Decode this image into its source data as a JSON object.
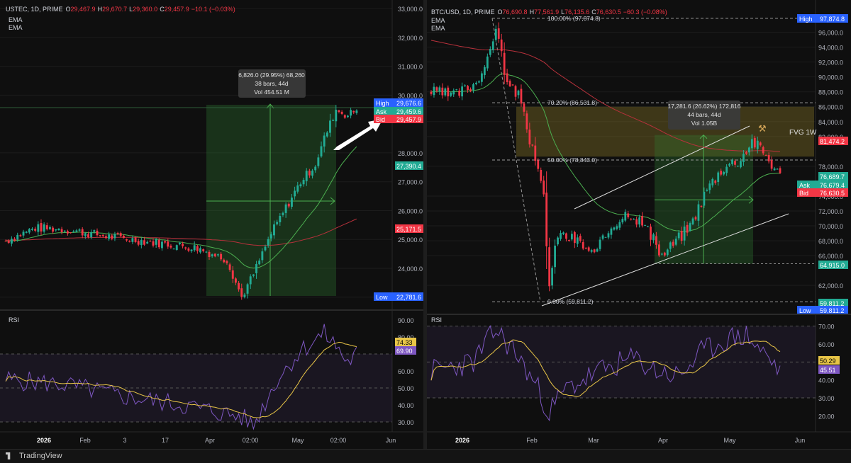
{
  "footer": {
    "brand": "TradingView"
  },
  "colors": {
    "up": "#22ab94",
    "down": "#f23645",
    "ema_green": "#4caf50",
    "ema_red": "#b7313b",
    "rsi": "#7e57c2",
    "rsi_ma": "#e8c547",
    "blue": "#2962ff"
  },
  "charts": [
    {
      "panel": "left",
      "header": {
        "symbol": "USTEC, 1D, PRIME",
        "o_label": "O",
        "o": "29,467.9",
        "h_label": "H",
        "h": "29,670.7",
        "l_label": "L",
        "l": "29,360.0",
        "c_label": "C",
        "c": "29,457.9",
        "chg": "−10.1 (−0.03%)"
      },
      "indicators": [
        "EMA",
        "EMA"
      ],
      "price_ticks": [
        "33,000.0",
        "32,000.0",
        "31,000.0",
        "30,000.0",
        "28,000.0",
        "27,000.0",
        "26,000.0",
        "25,000.0",
        "24,000.0",
        "23,000.0"
      ],
      "price_labels": [
        {
          "tag": "High",
          "value": "29,676.6",
          "color": "#2962ff"
        },
        {
          "tag": "Ask",
          "value": "29,459.6",
          "color": "#22ab94"
        },
        {
          "tag": "Bid",
          "value": "29,457.9",
          "color": "#f23645"
        },
        {
          "tag": "",
          "value": "27,390.4",
          "color": "#22ab94"
        },
        {
          "tag": "",
          "value": "25,171.5",
          "color": "#f23645"
        },
        {
          "tag": "Low",
          "value": "22,781.6",
          "color": "#2962ff"
        }
      ],
      "measure": {
        "line1": "6,826.0 (29.95%) 68,260",
        "line2": "38 bars, 44d",
        "line3": "Vol 454.51 M"
      },
      "rsi": {
        "label": "RSI",
        "ticks": [
          "90.00",
          "80.00",
          "60.00",
          "50.00",
          "40.00",
          "30.00"
        ],
        "value1": "74.33",
        "value2": "69.90"
      },
      "time_ticks": [
        "2026",
        "Feb",
        "3",
        "17",
        "Apr",
        "02:00",
        "May",
        "02:00",
        "Jun"
      ],
      "chart_data": {
        "type": "candlestick",
        "title": "USTEC, 1D, PRIME",
        "ylim": [
          22700,
          33100
        ],
        "ema_values": {
          "ema1_last": 27390.4,
          "ema2_last": 25171.5
        },
        "high": 29676.6,
        "low": 22781.6,
        "measure_range": [
          22781.6,
          29676.6
        ],
        "rsi_last": 69.9,
        "rsi_ma_last": 74.33
      }
    },
    {
      "panel": "right",
      "header": {
        "symbol": "BTC/USD, 1D, PRIME",
        "o_label": "O",
        "o": "76,690.8",
        "h_label": "H",
        "h": "77,561.9",
        "l_label": "L",
        "l": "76,135.6",
        "c_label": "C",
        "c": "76,630.5",
        "chg": "−60.3 (−0.08%)"
      },
      "indicators": [
        "EMA",
        "EMA"
      ],
      "price_ticks": [
        "96,000.0",
        "94,000.0",
        "92,000.0",
        "90,000.0",
        "88,000.0",
        "86,000.0",
        "84,000.0",
        "82,000.0",
        "78,000.0",
        "74,000.0",
        "72,000.0",
        "70,000.0",
        "68,000.0",
        "66,000.0",
        "62,000.0"
      ],
      "price_labels": [
        {
          "tag": "High",
          "value": "97,874.8",
          "color": "#2962ff"
        },
        {
          "tag": "",
          "value": "81,474.2",
          "color": "#f23645"
        },
        {
          "tag": "",
          "value": "76,689.7",
          "color": "#22ab94"
        },
        {
          "tag": "Ask",
          "value": "76,679.4",
          "color": "#22ab94"
        },
        {
          "tag": "Bid",
          "value": "76,630.5",
          "color": "#f23645"
        },
        {
          "tag": "",
          "value": "64,915.0",
          "color": "#22ab94"
        },
        {
          "tag": "",
          "value": "59,811.2",
          "color": "#22ab94"
        },
        {
          "tag": "Low",
          "value": "59,811.2",
          "color": "#2962ff"
        }
      ],
      "fib": [
        {
          "label": "100.00% (97,874.8)"
        },
        {
          "label": "70.20% (86,531.8)"
        },
        {
          "label": "50.00% (78,843.0)"
        },
        {
          "label": "0.00% (59,811.2)"
        }
      ],
      "fvg_label": "FVG 1W",
      "measure": {
        "line1": "17,281.6 (26.62%) 172,816",
        "line2": "44 bars, 44d",
        "line3": "Vol 1.05B"
      },
      "rsi": {
        "label": "RSI",
        "ticks": [
          "70.00",
          "60.00",
          "40.00",
          "30.00",
          "20.00"
        ],
        "value1": "50.29",
        "value2": "45.51"
      },
      "time_ticks": [
        "2026",
        "Feb",
        "Mar",
        "Apr",
        "May",
        "Jun"
      ],
      "chart_data": {
        "type": "candlestick",
        "title": "BTC/USD, 1D, PRIME",
        "ylim": [
          58500,
          99000
        ],
        "high": 97874.8,
        "low": 59811.2,
        "fvg_range": [
          79300,
          86000
        ],
        "measure_range": [
          64915.0,
          82196.6
        ],
        "rsi_last": 45.51,
        "rsi_ma_last": 50.29
      }
    }
  ]
}
